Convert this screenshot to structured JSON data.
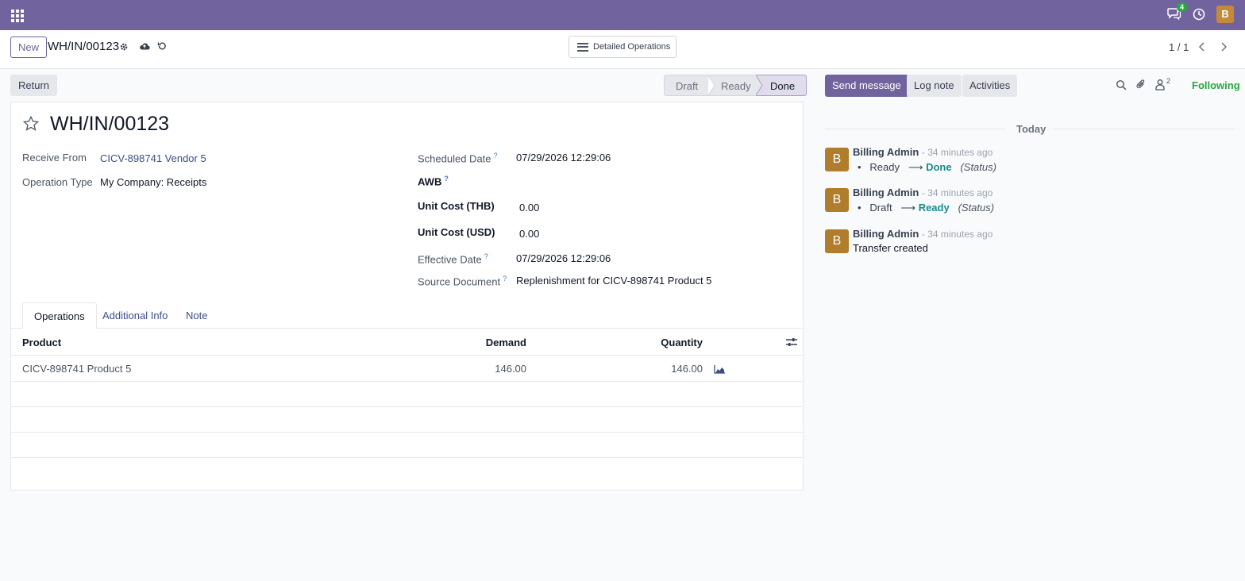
{
  "navbar": {
    "chat_badge": "4",
    "user_initial": "B",
    "color": "#71639e"
  },
  "control_panel": {
    "new_label": "New",
    "breadcrumb": "WH/IN/00123",
    "detailed_ops_label": "Detailed Operations",
    "pager": "1 / 1"
  },
  "statusbar": {
    "return_label": "Return",
    "steps": [
      "Draft",
      "Ready",
      "Done"
    ],
    "current": "Done"
  },
  "record": {
    "title": "WH/IN/00123",
    "fields_left": [
      {
        "label": "Receive From",
        "value": "CICV-898741 Vendor 5"
      },
      {
        "label": "Operation Type",
        "value": "My Company: Receipts"
      }
    ],
    "fields_right": [
      {
        "label": "Scheduled Date",
        "help": "?",
        "value": "07/29/2026 12:29:06"
      },
      {
        "label": "AWB",
        "help": "?",
        "value": ""
      },
      {
        "label": "Unit Cost (THB)",
        "value": "0.00"
      },
      {
        "label": "Unit Cost (USD)",
        "value": "0.00"
      },
      {
        "label": "Effective Date",
        "help": "?",
        "value": "07/29/2026 12:29:06"
      },
      {
        "label": "Source Document",
        "help": "?",
        "value": "Replenishment for CICV-898741 Product 5"
      }
    ]
  },
  "tabs": [
    "Operations",
    "Additional Info",
    "Note"
  ],
  "operations": {
    "columns": [
      "Product",
      "Demand",
      "Quantity"
    ],
    "rows": [
      {
        "product": "CICV-898741 Product 5",
        "demand": "146.00",
        "quantity": "146.00"
      }
    ]
  },
  "chatter": {
    "send_label": "Send message",
    "log_label": "Log note",
    "activities_label": "Activities",
    "follower_count": "2",
    "following_label": "Following",
    "date_separator": "Today",
    "messages": [
      {
        "initial": "B",
        "author": "Billing Admin",
        "time": "- 34 minutes ago",
        "old": "Ready",
        "arrow": "⟶",
        "new": "Done",
        "field": "(Status)"
      },
      {
        "initial": "B",
        "author": "Billing Admin",
        "time": "- 34 minutes ago",
        "old": "Draft",
        "arrow": "⟶",
        "new": "Ready",
        "field": "(Status)"
      },
      {
        "initial": "B",
        "author": "Billing Admin",
        "time": "- 34 minutes ago",
        "body": "Transfer created"
      }
    ]
  }
}
